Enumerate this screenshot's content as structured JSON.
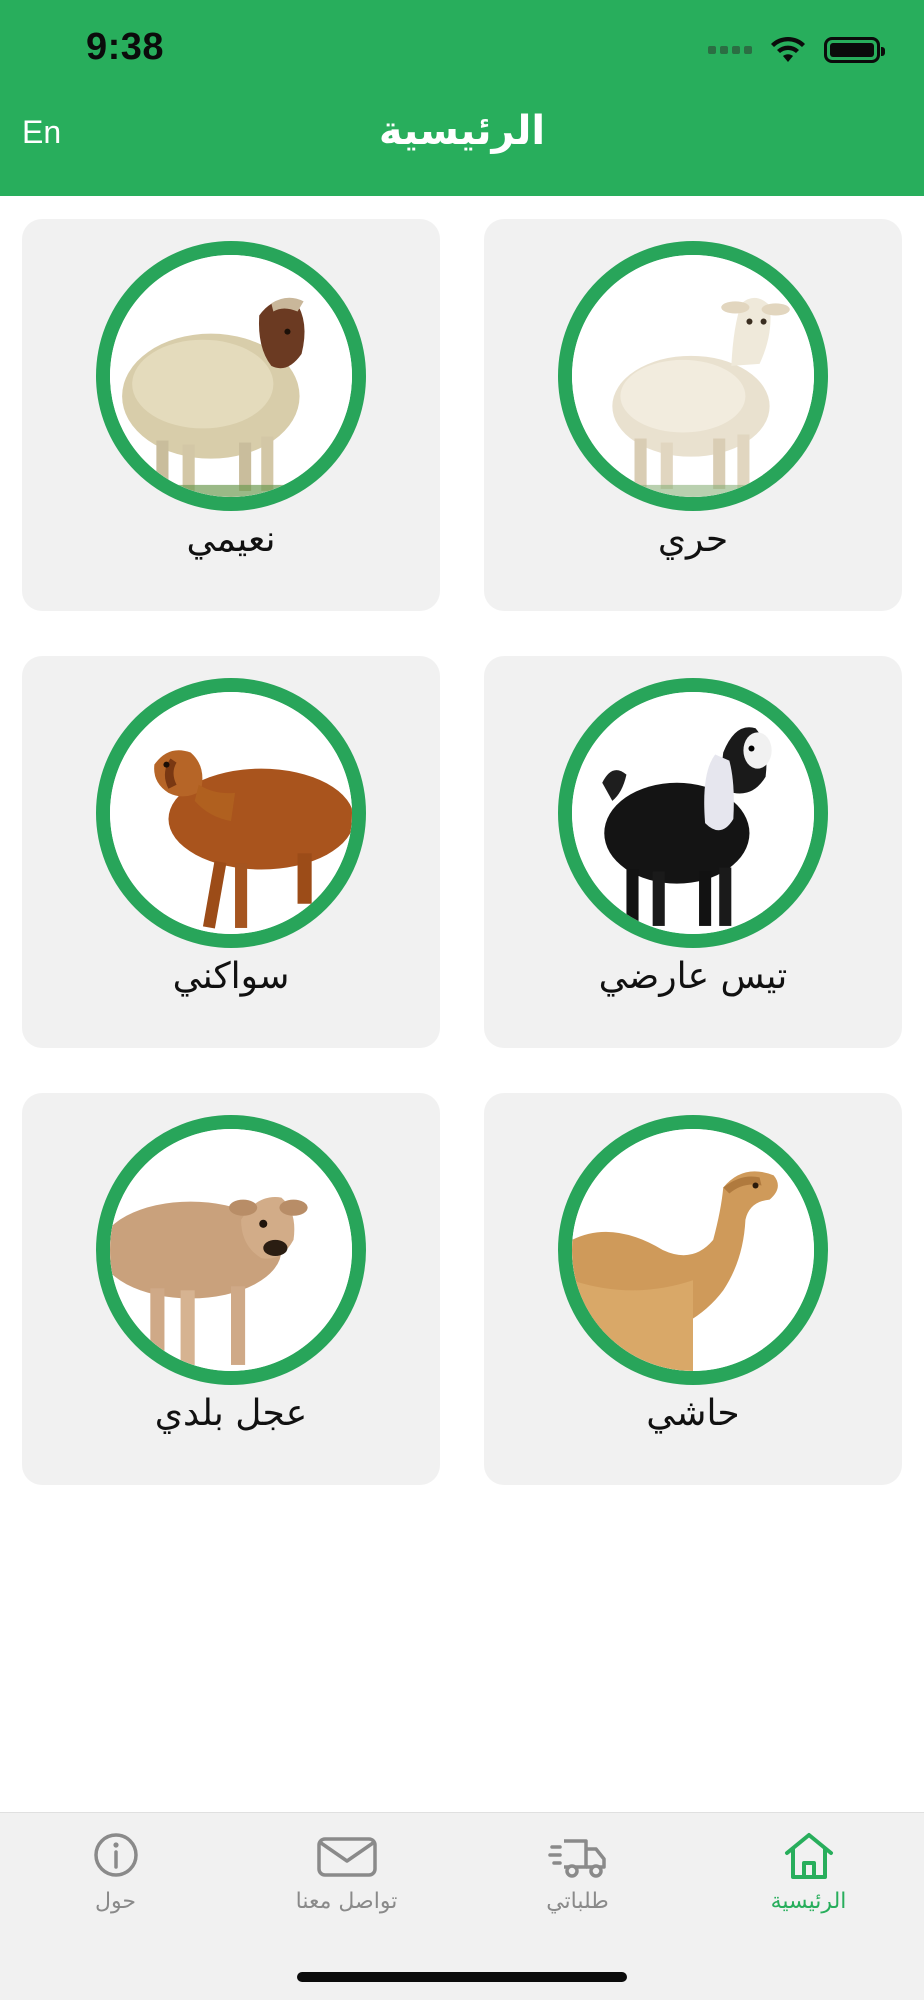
{
  "status_bar": {
    "time": "9:38"
  },
  "header": {
    "title": "الرئيسية",
    "language_toggle": "En"
  },
  "categories": [
    {
      "label": "حري",
      "animal": "sheep-white"
    },
    {
      "label": "نعيمي",
      "animal": "sheep-naimi"
    },
    {
      "label": "تيس عارضي",
      "animal": "goat-black"
    },
    {
      "label": "سواكني",
      "animal": "sheep-sawakni"
    },
    {
      "label": "حاشي",
      "animal": "camel"
    },
    {
      "label": "عجل بلدي",
      "animal": "calf"
    }
  ],
  "tabbar": {
    "tabs": [
      {
        "label": "الرئيسية",
        "icon": "home-icon",
        "active": true
      },
      {
        "label": "طلباتي",
        "icon": "delivery-truck-icon",
        "active": false
      },
      {
        "label": "تواصل معنا",
        "icon": "envelope-icon",
        "active": false
      },
      {
        "label": "حول",
        "icon": "info-icon",
        "active": false
      }
    ]
  },
  "colors": {
    "brand_green": "#28ae5c",
    "ring_green": "#28a55a",
    "card_bg": "#f1f1f1",
    "tab_inactive": "#8a8a8a"
  }
}
